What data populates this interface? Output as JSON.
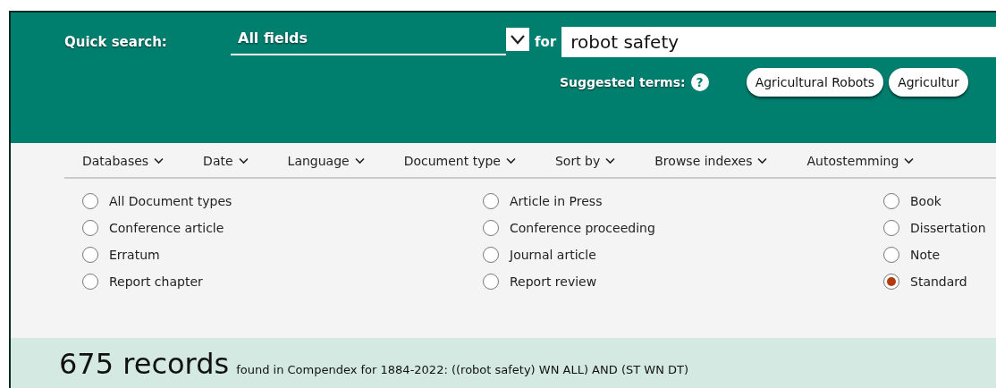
{
  "quick_search": {
    "label": "Quick search:",
    "field_select": {
      "value": "All fields"
    },
    "for_label": "for",
    "query": {
      "value": "robot safety"
    },
    "suggested_label": "Suggested terms:",
    "help_icon": "?",
    "suggested_terms": [
      "Agricultural Robots",
      "Agricultur"
    ]
  },
  "filters": [
    {
      "label": "Databases"
    },
    {
      "label": "Date"
    },
    {
      "label": "Language"
    },
    {
      "label": "Document type"
    },
    {
      "label": "Sort by"
    },
    {
      "label": "Browse indexes"
    },
    {
      "label": "Autostemming"
    }
  ],
  "document_types": [
    [
      {
        "label": "All Document types",
        "selected": false
      },
      {
        "label": "Conference article",
        "selected": false
      },
      {
        "label": "Erratum",
        "selected": false
      },
      {
        "label": "Report chapter",
        "selected": false
      }
    ],
    [
      {
        "label": "Article in Press",
        "selected": false
      },
      {
        "label": "Conference proceeding",
        "selected": false
      },
      {
        "label": "Journal article",
        "selected": false
      },
      {
        "label": "Report review",
        "selected": false
      }
    ],
    [
      {
        "label": "Book",
        "selected": false
      },
      {
        "label": "Dissertation",
        "selected": false
      },
      {
        "label": "Note",
        "selected": false
      },
      {
        "label": "Standard",
        "selected": true
      }
    ]
  ],
  "results": {
    "count": "675 records",
    "description": "found in Compendex for 1884-2022: ((robot safety) WN ALL) AND (ST WN DT)"
  }
}
